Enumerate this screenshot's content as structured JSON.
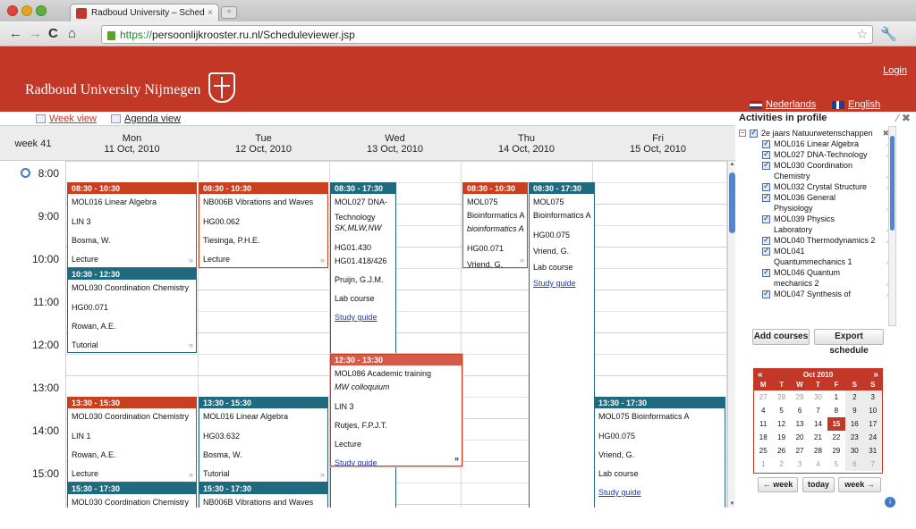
{
  "browser": {
    "tab_title": "Radboud University – Schedu",
    "tab_close": "×",
    "new_tab": "+",
    "url_scheme": "https://",
    "url_rest": "persoonlijkrooster.ru.nl/Scheduleviewer.jsp"
  },
  "header": {
    "brand": "Radboud University Nijmegen",
    "login": "Login",
    "lang_nl": "Nederlands",
    "lang_en": "English",
    "bg_color": "#c33726"
  },
  "views": {
    "week": "Week view",
    "agenda": "Agenda view"
  },
  "week_label": "week 41",
  "days": [
    {
      "name": "Mon",
      "date": "11 Oct, 2010"
    },
    {
      "name": "Tue",
      "date": "12 Oct, 2010"
    },
    {
      "name": "Wed",
      "date": "13 Oct, 2010"
    },
    {
      "name": "Thu",
      "date": "14 Oct, 2010"
    },
    {
      "name": "Fri",
      "date": "15 Oct, 2010"
    }
  ],
  "hours": [
    "8:00",
    "9:00",
    "10:00",
    "11:00",
    "12:00",
    "13:00",
    "14:00",
    "15:00"
  ],
  "events": {
    "mon1": {
      "time": "08:30 - 10:30",
      "course": "MOL016 Linear Algebra",
      "room": "LIN 3",
      "teacher": "Bosma, W.",
      "type": "Lecture"
    },
    "mon2": {
      "time": "10:30 - 12:30",
      "course": "MOL030 Coordination Chemistry",
      "room": "HG00.071",
      "teacher": "Rowan, A.E.",
      "type": "Tutorial"
    },
    "mon3": {
      "time": "13:30 - 15:30",
      "course": "MOL030 Coordination Chemistry",
      "room": "LIN 1",
      "teacher": "Rowan, A.E.",
      "type": "Lecture"
    },
    "mon4": {
      "time": "15:30 - 17:30",
      "course": "MOL030 Coordination Chemistry"
    },
    "tue1": {
      "time": "08:30 - 10:30",
      "course": "NB006B Vibrations and Waves",
      "room": "HG00.062",
      "teacher": "Tiesinga, P.H.E.",
      "type": "Lecture"
    },
    "tue2": {
      "time": "13:30 - 15:30",
      "course": "MOL016 Linear Algebra",
      "room": "HG03.632",
      "teacher": "Bosma, W.",
      "type": "Tutorial"
    },
    "tue3": {
      "time": "15:30 - 17:30",
      "course": "NB006B Vibrations and Waves"
    },
    "wed1": {
      "time": "08:30 - 17:30",
      "course1": "MOL027 DNA-",
      "course2": "Technology",
      "groups": "SK,MLW,NW",
      "room1": "HG01.430",
      "room2": "HG01.418/426",
      "teacher": "Pruijn, G.J.M.",
      "type": "Lab course",
      "link": "Study guide"
    },
    "wed2": {
      "time": "12:30 - 13:30",
      "course": "MOL086 Academic training",
      "sub": "MW colloquium",
      "room": "LIN 3",
      "teacher": "Rutjes, F.P.J.T.",
      "type": "Lecture",
      "link": "Study guide"
    },
    "thu1": {
      "time": "08:30 - 10:30",
      "course1": "MOL075",
      "course2": "Bioinformatics A",
      "sub": "bioinformatics A",
      "room": "HG00.071",
      "teacher": "Vriend, G."
    },
    "thu2": {
      "time": "08:30 - 17:30",
      "course1": "MOL075",
      "course2": "Bioinformatics A",
      "room": "HG00.075",
      "teacher": "Vriend, G.",
      "type": "Lab course",
      "link": "Study guide"
    },
    "fri1": {
      "time": "13:30 - 17:30",
      "course": "MOL075 Bioinformatics A",
      "room": "HG00.075",
      "teacher": "Vriend, G.",
      "type": "Lab course",
      "link": "Study guide"
    }
  },
  "more_glyph": "»",
  "panel": {
    "title": "Activities in profile",
    "group": "2e jaars Natuurwetenschappen",
    "items": [
      [
        "MOL016 Linear Algebra"
      ],
      [
        "MOL027 DNA-Technology"
      ],
      [
        "MOL030 Coordination",
        "Chemistry"
      ],
      [
        "MOL032 Crystal Structure"
      ],
      [
        "MOL036 General",
        "Physiology"
      ],
      [
        "MOL039 Physics",
        "Laboratory"
      ],
      [
        "MOL040 Thermodynamics 2"
      ],
      [
        "MOL041",
        "Quantummechanics 1"
      ],
      [
        "MOL046 Quantum",
        "mechanics 2"
      ],
      [
        "MOL047 Synthesis of"
      ]
    ],
    "add_courses": "Add courses",
    "export": "Export schedule"
  },
  "calendar": {
    "month": "Oct 2010",
    "prev": "«",
    "next": "»",
    "weekdays": [
      "M",
      "T",
      "W",
      "T",
      "F",
      "S",
      "S"
    ],
    "rows": [
      [
        "27",
        "28",
        "29",
        "30",
        "1",
        "2",
        "3"
      ],
      [
        "4",
        "5",
        "6",
        "7",
        "8",
        "9",
        "10"
      ],
      [
        "11",
        "12",
        "13",
        "14",
        "15",
        "16",
        "17"
      ],
      [
        "18",
        "19",
        "20",
        "21",
        "22",
        "23",
        "24"
      ],
      [
        "25",
        "26",
        "27",
        "28",
        "29",
        "30",
        "31"
      ],
      [
        "1",
        "2",
        "3",
        "4",
        "5",
        "6",
        "7"
      ]
    ],
    "prev_week": "← week",
    "today": "today",
    "next_week": "week →"
  }
}
